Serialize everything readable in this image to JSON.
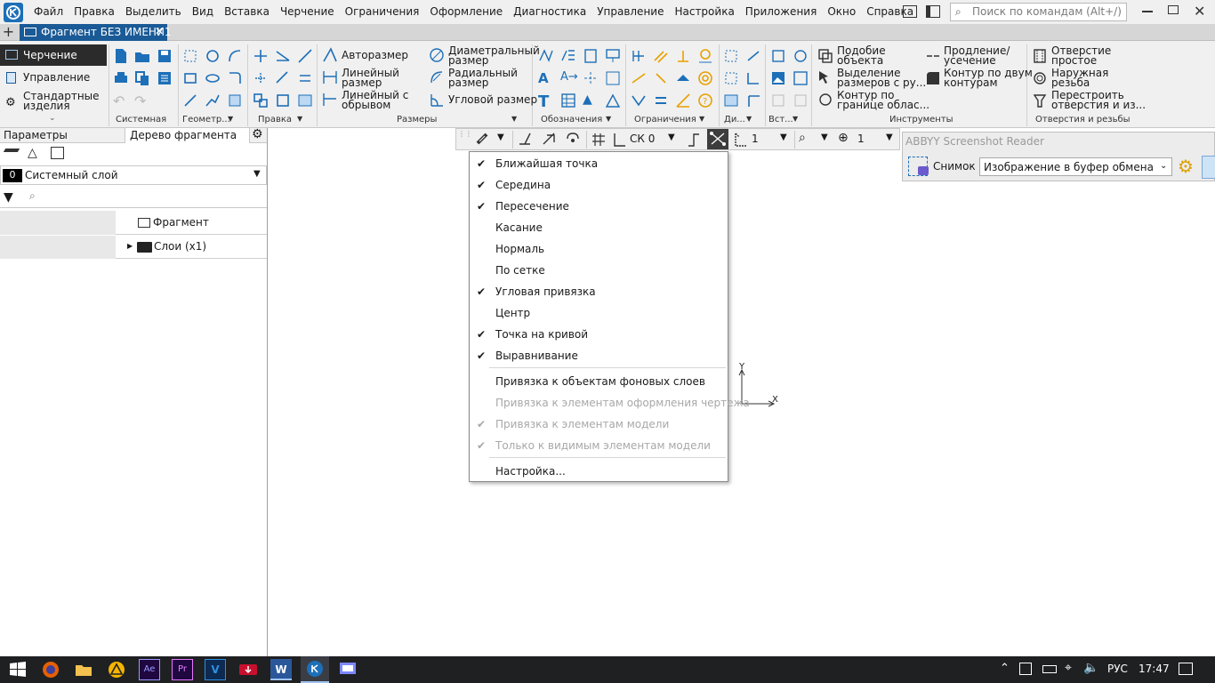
{
  "menubar": {
    "items": [
      "Файл",
      "Правка",
      "Выделить",
      "Вид",
      "Вставка",
      "Черчение",
      "Ограничения",
      "Оформление",
      "Диагностика",
      "Управление",
      "Настройка",
      "Приложения",
      "Окно",
      "Справка"
    ],
    "search_placeholder": "Поиск по командам (Alt+/)"
  },
  "tabs": {
    "doc_tab": "Фрагмент БЕЗ ИМЕНИ1"
  },
  "ribbon": {
    "modes": [
      "Черчение",
      "Управление",
      "Стандартные изделия"
    ],
    "groups": [
      "Системная",
      "Геометр...",
      "Правка",
      "Размеры",
      "Обозначения",
      "Ограничения",
      "Ди...",
      "Вст...",
      "Инструменты",
      "Отверстия и резьбы"
    ],
    "dims": {
      "auto": "Авторазмер",
      "linear1": "Линейный",
      "linear2": "размер",
      "linbreak1": "Линейный с",
      "linbreak2": "обрывом",
      "diam1": "Диаметральный",
      "diam2": "размер",
      "rad1": "Радиальный",
      "rad2": "размер",
      "angle": "Угловой размер"
    },
    "tools": {
      "similar1": "Подобие",
      "similar2": "объекта",
      "select1": "Выделение",
      "select2": "размеров с ру...",
      "contour1": "Контур по",
      "contour2": "границе облас...",
      "extend1": "Продление/",
      "extend2": "усечение",
      "twocont1": "Контур по двум",
      "twocont2": "контурам"
    },
    "holes": {
      "hole1": "Отверстие",
      "hole2": "простое",
      "thread1": "Наружная",
      "thread2": "резьба",
      "rebuild1": "Перестроить",
      "rebuild2": "отверстия и из..."
    }
  },
  "leftpanel": {
    "tab_params": "Параметры",
    "tab_tree": "Дерево фрагмента",
    "layer_num": "0",
    "layer_name": "Системный слой",
    "tree_root": "Фрагмент",
    "tree_layers": "Слои (x1)"
  },
  "drawbar": {
    "cs": "СК 0",
    "step": "1",
    "zoom": "1"
  },
  "abbyy": {
    "title": "ABBYY Screenshot Reader",
    "snapshot": "Снимок",
    "target": "Изображение в буфер обмена"
  },
  "popup": {
    "items": [
      {
        "label": "Ближайшая точка",
        "checked": true,
        "disabled": false
      },
      {
        "label": "Середина",
        "checked": true,
        "disabled": false
      },
      {
        "label": "Пересечение",
        "checked": true,
        "disabled": false
      },
      {
        "label": "Касание",
        "checked": false,
        "disabled": false
      },
      {
        "label": "Нормаль",
        "checked": false,
        "disabled": false
      },
      {
        "label": "По сетке",
        "checked": false,
        "disabled": false
      },
      {
        "label": "Угловая привязка",
        "checked": true,
        "disabled": false
      },
      {
        "label": "Центр",
        "checked": false,
        "disabled": false
      },
      {
        "label": "Точка на кривой",
        "checked": true,
        "disabled": false
      },
      {
        "label": "Выравнивание",
        "checked": true,
        "disabled": false
      }
    ],
    "items2": [
      {
        "label": "Привязка к объектам фоновых слоев",
        "checked": false,
        "disabled": false
      },
      {
        "label": "Привязка к элементам оформления чертежа",
        "checked": false,
        "disabled": true
      },
      {
        "label": "Привязка к элементам модели",
        "checked": true,
        "disabled": true
      },
      {
        "label": "Только к видимым элементам модели",
        "checked": true,
        "disabled": true
      }
    ],
    "settings": "Настройка..."
  },
  "canvas": {
    "axis_x": "X",
    "axis_y": "Y"
  },
  "taskbar": {
    "lang": "РУС",
    "time": "17:47"
  },
  "colors": {
    "accent": "#1a5a96",
    "mode_active_bg": "#2b2b2b",
    "taskbar": "#1f2022"
  }
}
